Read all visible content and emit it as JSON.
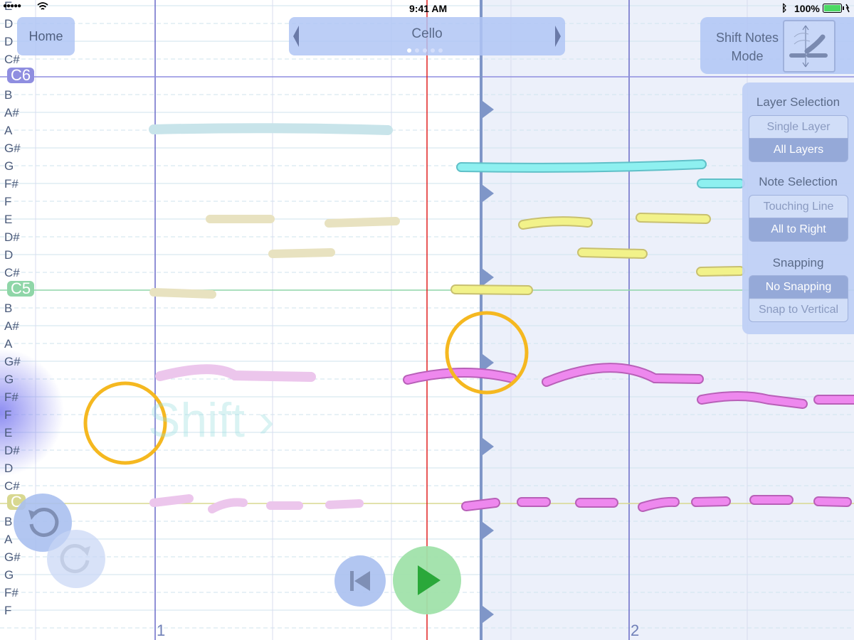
{
  "status_bar": {
    "time": "9:41 AM",
    "battery": "100%",
    "signal_dots": "●●●●●"
  },
  "toolbar": {
    "home_label": "Home",
    "instrument_label": "Cello",
    "shift_mode_label_line1": "Shift Notes",
    "shift_mode_label_line2": "Mode"
  },
  "overlay": {
    "gesture_hint": "Shift ›"
  },
  "panel": {
    "layer_title": "Layer Selection",
    "layer_options": [
      "Single Layer",
      "All Layers"
    ],
    "layer_selected": "All Layers",
    "note_title": "Note Selection",
    "note_options": [
      "Touching Line",
      "All to Right"
    ],
    "note_selected": "All to Right",
    "snap_title": "Snapping",
    "snap_options": [
      "No Snapping",
      "Snap to Vertical"
    ],
    "snap_selected": "No Snapping"
  },
  "pitch_labels": [
    "E",
    "D",
    "D",
    "C#",
    "C6",
    "B",
    "A#",
    "A",
    "G#",
    "G",
    "F#",
    "F",
    "E",
    "D#",
    "D",
    "C#",
    "C5",
    "B",
    "A#",
    "A",
    "G#",
    "G",
    "F#",
    "F",
    "E",
    "D#",
    "D",
    "C#",
    "C",
    "B",
    "A",
    "G#",
    "G",
    "F#",
    "F"
  ],
  "measure_labels": [
    "1",
    "2"
  ],
  "colors": {
    "accent": "#b0c6f5",
    "c6": "#8f8ee0",
    "c5": "#8fd6a8",
    "c4": "#d8d890",
    "cursor": "#e02020",
    "highlight_ring": "#f5b820",
    "play": "#2aa83a"
  },
  "icons": {
    "undo": "undo-icon",
    "redo": "redo-icon",
    "rewind": "skip-back-icon",
    "play": "play-icon",
    "shift_mode": "shift-notes-icon"
  }
}
